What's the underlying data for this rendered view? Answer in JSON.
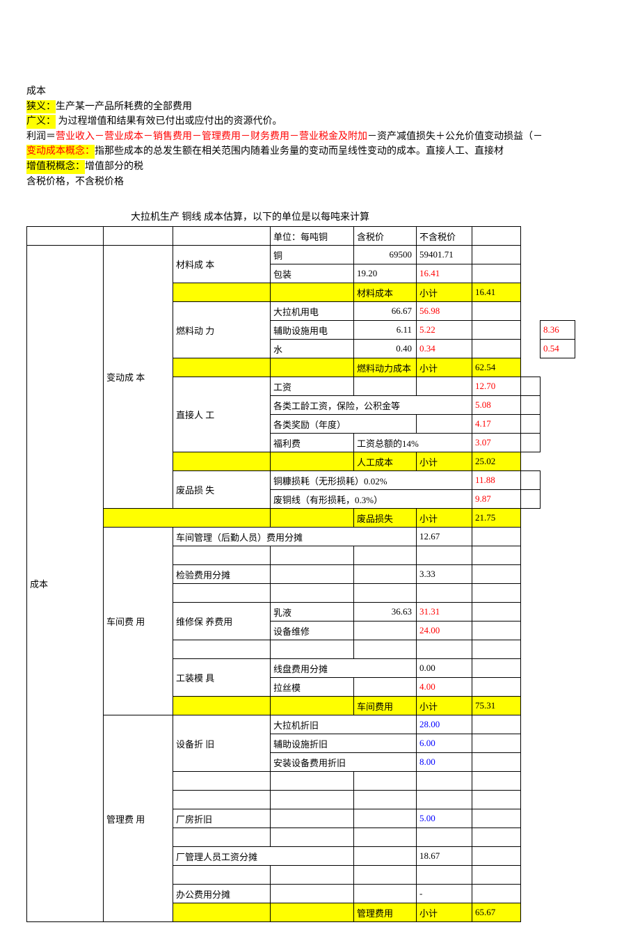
{
  "intro": {
    "l1": "成本",
    "l2a": "狭义：",
    "l2b": "生产某一产品所耗费的全部费用",
    "l3a": "广义：",
    "l3b": " 为过程增值和结果有效已付出或应付出的资源代价。",
    "l4a": "利润＝",
    "l4b": "营业收入－营业成本－销售费用－管理费用－财务费用－营业税金及附加",
    "l4c": "－资产减值损失＋公允价值变动损益（－",
    "l5a": "变动成本概念：",
    "l5b": "指那些成本的总发生额在相关范围内随着业务量的变动而呈线性变动的成本。直接人工、直接材",
    "l6a": "增值税概念：",
    "l6b": "增值部分的税",
    "l7": "含税价格，不含税价格"
  },
  "title": "大拉机生产 铜线 成本估算，以下的单位是以每吨来计算",
  "hdr": {
    "unit": "单位：每吨铜",
    "tax": "含税价",
    "notax": "不含税价"
  },
  "root": "成本",
  "g1": {
    "name": "变动成\n本",
    "s1": {
      "name": "材料成\n本",
      "r1": {
        "item": "铜",
        "v1": "69500",
        "v2": "59401.71"
      },
      "r2": {
        "item": "包装",
        "v1": "19.20",
        "v2": "16.41"
      },
      "sub": {
        "label": "材料成本",
        "xj": "小计",
        "v": "16.41"
      }
    },
    "s2": {
      "name": "燃料动\n力",
      "r1": {
        "item": "大拉机用电",
        "v1": "66.67",
        "v2": "56.98"
      },
      "r2": {
        "item": "辅助设施用电",
        "v1": "6.11",
        "v2": "5.22",
        "ext": "8.36"
      },
      "r3": {
        "item": "水",
        "v1": "0.40",
        "v2": "0.34",
        "ext": "0.54"
      },
      "sub": {
        "label": "燃料动力成本",
        "xj": "小计",
        "v": "62.54"
      }
    },
    "s3": {
      "name": "直接人\n工",
      "r1": {
        "item": "工资",
        "v2": "12.70"
      },
      "r2": {
        "item": "各类工龄工资，保险，公积金等",
        "v2": "5.08"
      },
      "r3": {
        "item": "各类奖励（年度）",
        "v2": "4.17"
      },
      "r4": {
        "item": "福利费",
        "desc": "工资总额的14%",
        "v2": "3.07"
      },
      "sub": {
        "label": "人工成本",
        "xj": "小计",
        "v": "25.02"
      }
    },
    "s4": {
      "name": "废品损\n失",
      "r1": {
        "item": "铜糠损耗（无形损耗）0.02%",
        "v2": "11.88"
      },
      "r2": {
        "item": "废铜线（有形损耗，0.3%）",
        "v2": "9.87"
      },
      "sub": {
        "label": "废品损失",
        "xj": "小计",
        "v": "21.75"
      }
    }
  },
  "g2": {
    "name": "车间费\n用",
    "r1": {
      "item": "车间管理（后勤人员）费用分摊",
      "v": "12.67"
    },
    "r2": {
      "item": "检验费用分摊",
      "v": "3.33"
    },
    "s1": {
      "name": "维修保\n养费用",
      "r1": {
        "item": "乳液",
        "v1": "36.63",
        "v2": "31.31"
      },
      "r2": {
        "item": "设备维修",
        "v2": "24.00"
      }
    },
    "s2": {
      "name": "工装模\n具",
      "r1": {
        "item": "线盘费用分摊",
        "v": "0.00"
      },
      "r2": {
        "item": "拉丝模",
        "v": "4.00"
      }
    },
    "sub": {
      "label": "车间费用",
      "xj": "小计",
      "v": "75.31"
    }
  },
  "g3": {
    "name": "管理费\n用",
    "s1": {
      "name": "设备折\n旧",
      "r1": {
        "item": "大拉机折旧",
        "v": "28.00"
      },
      "r2": {
        "item": "辅助设施折旧",
        "v": "6.00"
      },
      "r3": {
        "item": "安装设备费用折旧",
        "v": "8.00"
      }
    },
    "r2": {
      "item": "厂房折旧",
      "v": "5.00"
    },
    "r3": {
      "item": "厂管理人员工资分摊",
      "v": "18.67"
    },
    "r4": {
      "item": "办公费用分摊",
      "v": "-"
    },
    "sub": {
      "label": "管理费用",
      "xj": "小计",
      "v": "65.67"
    }
  }
}
